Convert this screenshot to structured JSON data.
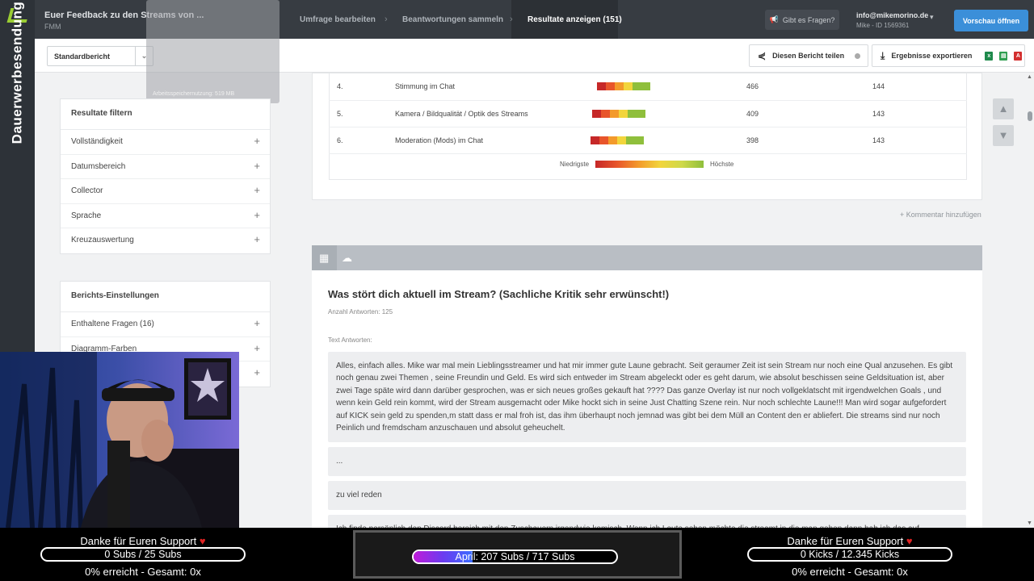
{
  "ad_badge": {
    "text": "Dauerwerbesendung"
  },
  "topbar": {
    "survey_title": "Euer Feedback zu den Streams von ...",
    "survey_sub": "FMM",
    "steps": [
      "Umfrage bearbeiten",
      "Beantwortungen sammeln",
      "Resultate anzeigen (151)"
    ],
    "questions_button": "Gibt es Fragen?",
    "user_email": "info@mikemorino.de",
    "user_id": "Mike - ID 1569361",
    "preview_button": "Vorschau öffnen"
  },
  "memory_overlay": "Arbeitsspeichernutzung: 519 MB",
  "toolbar": {
    "report_select": "Standardbericht",
    "share_label": "Diesen Bericht teilen",
    "export_label": "Ergebnisse exportieren"
  },
  "filter_panel": {
    "title": "Resultate filtern",
    "items": [
      "Vollständigkeit",
      "Datumsbereich",
      "Collector",
      "Sprache",
      "Kreuzauswertung"
    ]
  },
  "settings_panel": {
    "title": "Berichts-Einstellungen",
    "items": [
      "Enthaltene Fragen (16)",
      "Diagramm-Farben",
      ""
    ]
  },
  "ranking_table": {
    "rows": [
      {
        "rank": "4.",
        "label": "Stimmung im Chat",
        "score": "466",
        "count": "144"
      },
      {
        "rank": "5.",
        "label": "Kamera / Bildqualität / Optik des Streams",
        "score": "409",
        "count": "143"
      },
      {
        "rank": "6.",
        "label": "Moderation (Mods) im Chat",
        "score": "398",
        "count": "143"
      }
    ],
    "legend_low": "Niedrigste",
    "legend_high": "Höchste",
    "heat_colors": [
      "#c62828",
      "#e8552b",
      "#f39a2b",
      "#f2d53c",
      "#8fbf3c",
      "#8fbf3c"
    ]
  },
  "add_comment": "+ Kommentar hinzufügen",
  "question": {
    "title": "Was stört dich aktuell im Stream? (Sachliche Kritik sehr erwünscht!)",
    "count": "Anzahl Antworten: 125",
    "text_label": "Text Antworten:",
    "answers": [
      "Alles, einfach alles. Mike war mal mein Lieblingsstreamer und hat mir immer gute Laune gebracht. Seit geraumer Zeit ist sein Stream nur noch eine Qual anzusehen. Es gibt noch genau zwei Themen , seine Freundin und Geld. Es wird sich entweder im Stream abgeleckt oder es geht darum, wie absolut beschissen seine Geldsituation ist, aber zwei Tage späte wird dann darüber gesprochen, was er sich neues großes gekauft hat ???? Das ganze Overlay ist nur noch vollgeklatscht mit irgendwelchen Goals , und wenn kein Geld rein kommt, wird der Stream ausgemacht oder Mike hockt sich in seine Just Chatting Szene rein. Nur noch schlechte Laune!!! Man wird sogar aufgefordert auf KICK sein geld zu spenden,m statt dass er mal froh ist, das ihm überhaupt noch jemnad was gibt bei dem Müll an Content den er abliefert. Die streams sind nur noch Peinlich und fremdscham anzuschauen und absolut geheuchelt.",
      "...",
      "zu viel reden",
      "Ich finde persönlich den Discord bereich mit den Zuschauern irgendwie komisch. Wenn ich Leute sehen möchte die streamt in die man gehen dann hab ich das auf"
    ]
  },
  "stream_overlay": {
    "left": {
      "title": "Danke für Euren Support",
      "bar": "0 Subs / 25 Subs",
      "progress": 0,
      "footer": "0% erreicht - Gesamt: 0x"
    },
    "center": {
      "bar": "April: 207 Subs / 717 Subs",
      "progress": 0.289
    },
    "right": {
      "title": "Danke für Euren Support",
      "bar": "0 Kicks / 12.345 Kicks",
      "progress": 0,
      "footer": "0% erreicht - Gesamt: 0x"
    }
  }
}
